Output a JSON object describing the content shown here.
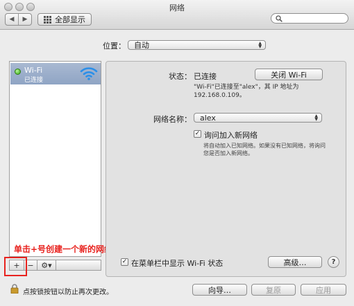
{
  "window": {
    "title": "网络"
  },
  "toolbar": {
    "show_all_label": "全部显示",
    "back_icon": "◀",
    "forward_icon": "▶"
  },
  "location": {
    "label": "位置：",
    "value": "自动"
  },
  "services": [
    {
      "name": "Wi-Fi",
      "status": "已连接"
    }
  ],
  "list_tools": {
    "add": "+",
    "remove": "−",
    "gear": "⚙▾"
  },
  "annotation": {
    "text": "单击+号创建一个新的网络连接"
  },
  "detail": {
    "status_label": "状态：",
    "status_value": "已连接",
    "turn_off_wifi": "关闭 Wi-Fi",
    "status_desc_line1": "\"Wi-Fi\"已连接至\"alex\"，其 IP 地址为",
    "status_desc_line2": "192.168.0.109。",
    "network_name_label": "网络名称：",
    "network_name_value": "alex",
    "ask_join_label": "询问加入新网络",
    "ask_join_desc_line1": "将自动加入已知网络。如果没有已知网络，将询问",
    "ask_join_desc_line2": "您是否加入新网络。",
    "show_menubar_label": "在菜单栏中显示 Wi-Fi 状态",
    "advanced_label": "高级…",
    "help_label": "?"
  },
  "bottom": {
    "lock_text": "点按锁按钮以防止再次更改。",
    "assist_label": "向导…",
    "revert_label": "复原",
    "apply_label": "应用"
  },
  "colors": {
    "accent": "#e8231f",
    "selection": "#9aaecb",
    "connected": "#33a813"
  }
}
